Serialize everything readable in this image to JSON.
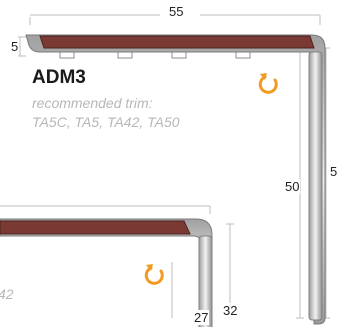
{
  "diagram": {
    "product": "ADM3",
    "trim_heading": "recommended trim:",
    "trim_options": "TA5C, TA5, TA42, TA50",
    "second_note_fragment": "42",
    "dimensions": {
      "top_width": "55",
      "tread_height": "5",
      "inner_height": "50",
      "outer_height": "5",
      "second_inner_height": "27",
      "second_outer_height": "32"
    },
    "colors": {
      "insert": "#7a3a33",
      "aluminium": "#cfcfcf",
      "accent": "#f29a1f",
      "dimension_line": "#bdbdbd"
    },
    "icons": [
      "rotate-arrow-icon",
      "rotate-arrow-icon"
    ]
  }
}
